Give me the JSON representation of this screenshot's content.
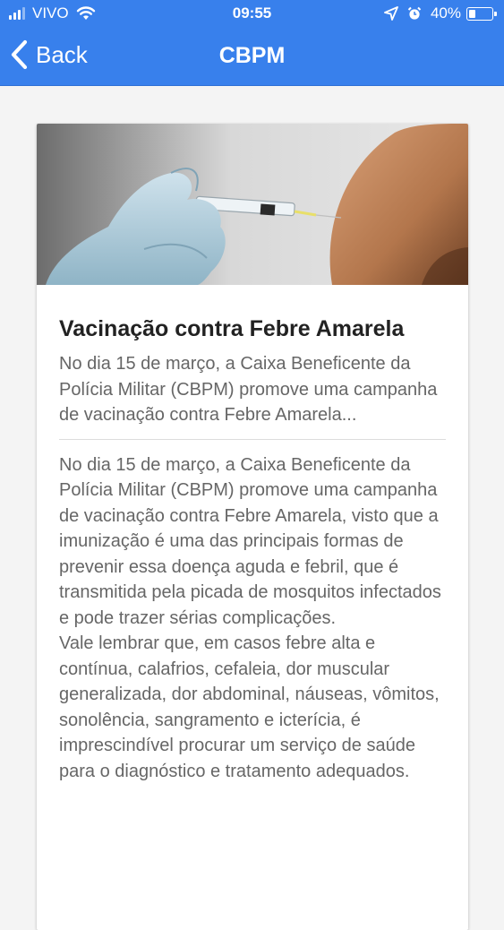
{
  "status_bar": {
    "carrier": "VIVO",
    "time": "09:55",
    "battery_percent": "40%",
    "battery_level": 0.4,
    "signal_icon": "signal-bars-icon",
    "wifi_icon": "wifi-icon",
    "location_icon": "location-arrow-icon",
    "alarm_icon": "alarm-clock-icon"
  },
  "nav": {
    "back_label": "Back",
    "title": "CBPM",
    "color": "#3880ec"
  },
  "article": {
    "image_icon": "vaccine-syringe-image",
    "title": "Vacinação contra Febre Amarela",
    "summary": "No dia 15 de março, a Caixa Beneficente da Polícia Militar (CBPM) promove uma campanha de vacinação contra Febre Amarela...",
    "paragraphs": [
      "No dia 15 de março, a Caixa Beneficente da Polícia Militar (CBPM) promove uma campanha de vacinação contra Febre Amarela, visto que a imunização é uma das principais formas de prevenir essa doença aguda e febril, que é transmitida pela picada de mosquitos infectados e pode trazer sérias complicações.",
      "Vale lembrar que, em casos febre alta e contínua, calafrios, cefaleia, dor muscular generalizada, dor abdominal, náuseas, vômitos, sonolência, sangramento e icterícia, é imprescindível procurar um serviço de saúde para o diagnóstico e tratamento adequados."
    ]
  }
}
